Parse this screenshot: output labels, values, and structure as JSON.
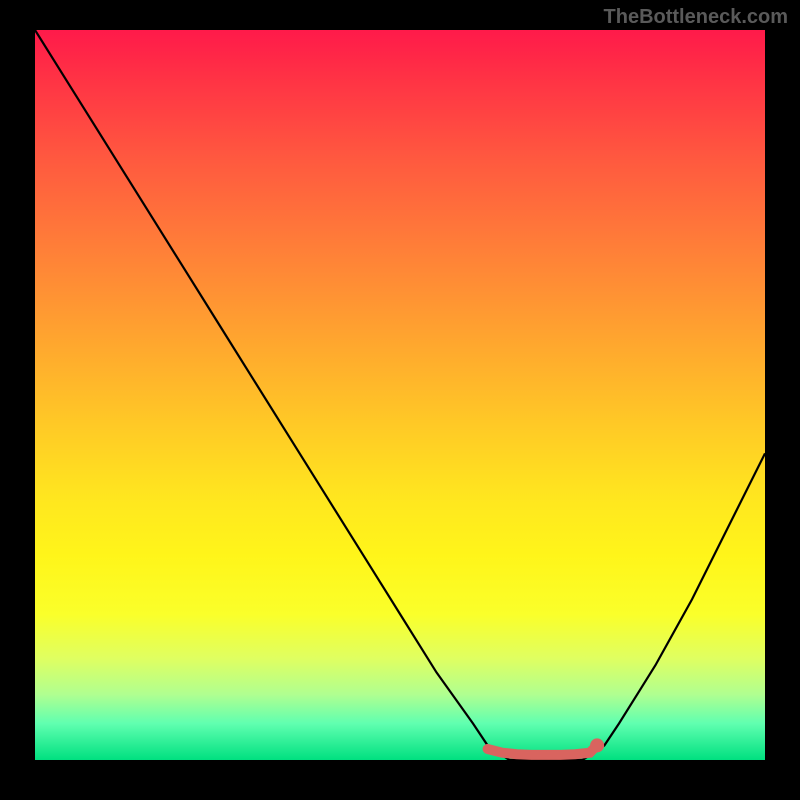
{
  "watermark": "TheBottleneck.com",
  "chart_data": {
    "type": "line",
    "title": "",
    "xlabel": "",
    "ylabel": "",
    "xlim": [
      0,
      100
    ],
    "ylim": [
      0,
      100
    ],
    "series": [
      {
        "name": "bottleneck-curve",
        "color": "#000000",
        "x": [
          0,
          5,
          10,
          15,
          20,
          25,
          30,
          35,
          40,
          45,
          50,
          55,
          60,
          62,
          65,
          68,
          70,
          72,
          75,
          78,
          80,
          85,
          90,
          95,
          100
        ],
        "y": [
          100,
          92,
          84,
          76,
          68,
          60,
          52,
          44,
          36,
          28,
          20,
          12,
          5,
          2,
          0,
          0,
          0,
          0,
          0,
          2,
          5,
          13,
          22,
          32,
          42
        ]
      },
      {
        "name": "optimal-region",
        "color": "#d9645f",
        "x": [
          62,
          64,
          66,
          68,
          70,
          72,
          74,
          76,
          77
        ],
        "y": [
          1.5,
          1,
          0.8,
          0.7,
          0.7,
          0.7,
          0.8,
          1,
          2
        ]
      }
    ],
    "optimal_marker": {
      "x": 77,
      "y": 2,
      "color": "#d9645f"
    },
    "gradient_stops": [
      {
        "pos": 0,
        "color": "#ff1a4a"
      },
      {
        "pos": 18,
        "color": "#ff5a3f"
      },
      {
        "pos": 42,
        "color": "#ffa42f"
      },
      {
        "pos": 72,
        "color": "#fff51a"
      },
      {
        "pos": 100,
        "color": "#00e080"
      }
    ]
  }
}
